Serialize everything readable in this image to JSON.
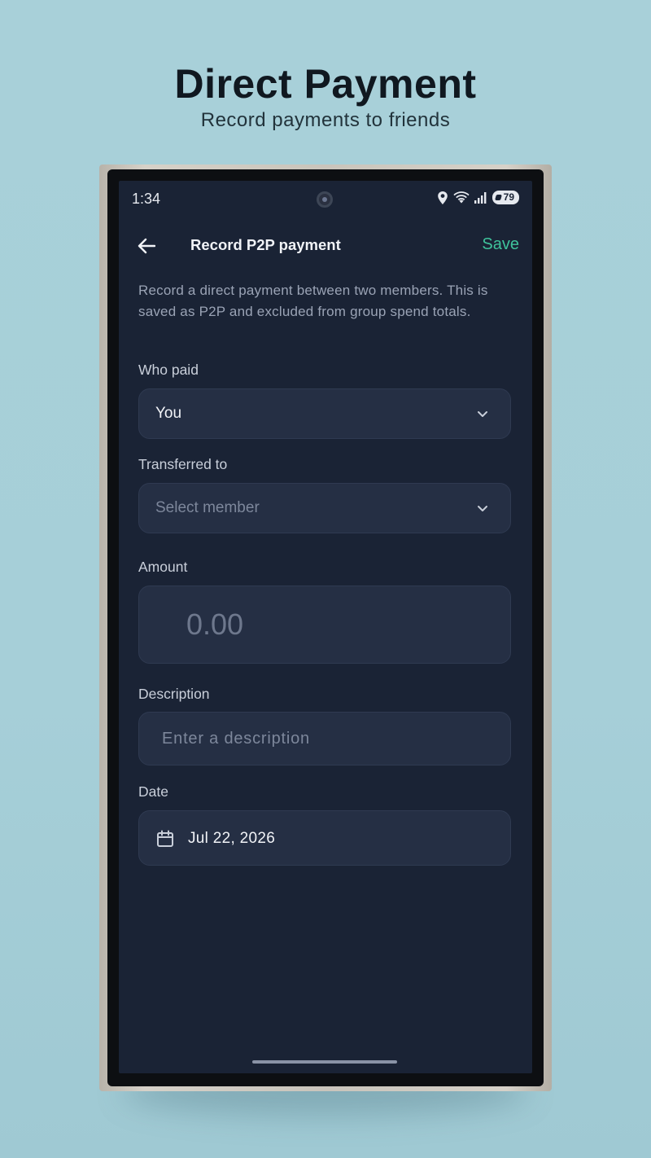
{
  "promo": {
    "title": "Direct Payment",
    "subtitle": "Record payments to friends"
  },
  "status_bar": {
    "time": "1:34",
    "battery": "79",
    "icons": [
      "location-icon",
      "wifi-icon",
      "signal-icon",
      "battery-icon"
    ]
  },
  "app_bar": {
    "title": "Record P2P payment",
    "save_label": "Save",
    "back_icon": "back-arrow-icon"
  },
  "help_text": "Record a direct payment between two members. This is saved as P2P and excluded from group spend totals.",
  "form": {
    "who_paid": {
      "label": "Who paid",
      "value": "You"
    },
    "transferred_to": {
      "label": "Transferred to",
      "placeholder": "Select member"
    },
    "amount": {
      "label": "Amount",
      "placeholder": "0.00"
    },
    "description": {
      "label": "Description",
      "placeholder": "Enter a description"
    },
    "date": {
      "label": "Date",
      "value": "Jul 22, 2026"
    }
  },
  "colors": {
    "background": "#a8d0d9",
    "screen": "#1a2335",
    "field": "#252f44",
    "accent": "#3fc29b"
  }
}
